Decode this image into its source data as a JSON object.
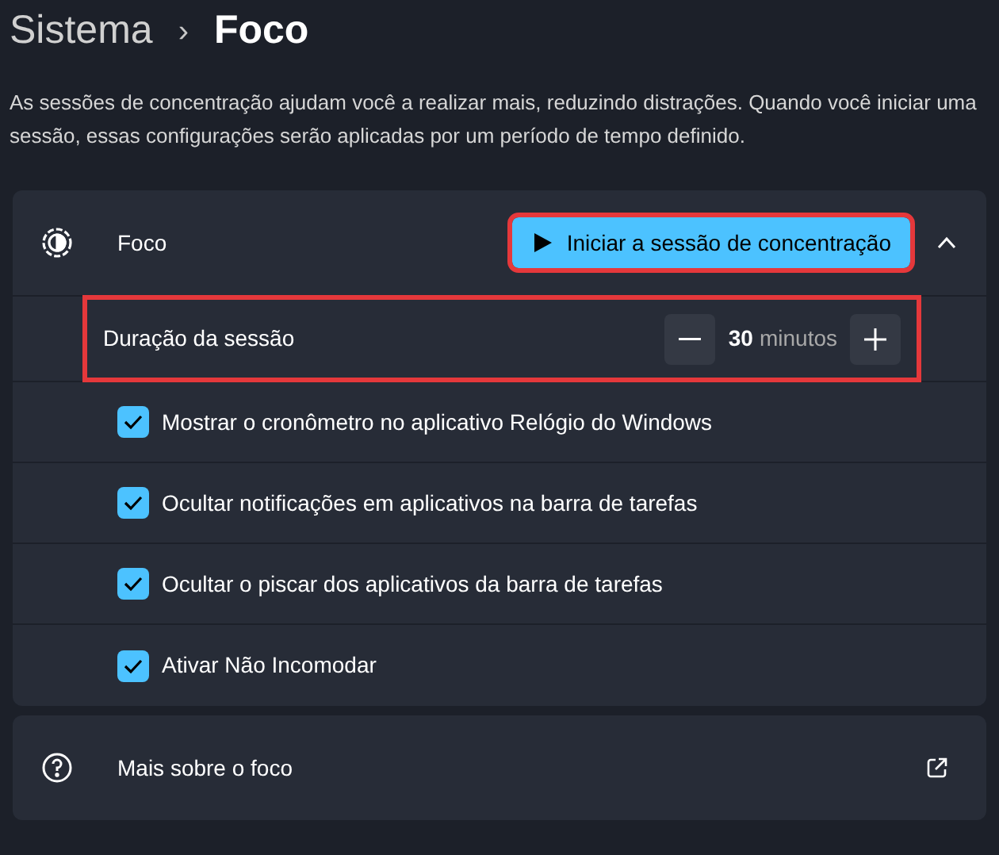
{
  "breadcrumb": {
    "parent": "Sistema",
    "separator": "›",
    "current": "Foco"
  },
  "description": "As sessões de concentração ajudam você a realizar mais, reduzindo distrações. Quando você iniciar uma sessão, essas configurações serão aplicadas por um período de tempo definido.",
  "focus_card": {
    "title": "Foco",
    "expanded": true,
    "start_button": {
      "label": "Iniciar a sessão de concentração",
      "highlighted": true
    },
    "duration": {
      "label": "Duração da sessão",
      "value": "30",
      "unit": "minutos",
      "highlighted": true
    },
    "options": [
      {
        "label": "Mostrar o cronômetro no aplicativo Relógio do Windows",
        "checked": true
      },
      {
        "label": "Ocultar notificações em aplicativos na barra de tarefas",
        "checked": true
      },
      {
        "label": "Ocultar o piscar dos aplicativos da barra de tarefas",
        "checked": true
      },
      {
        "label": "Ativar Não Incomodar",
        "checked": true
      }
    ]
  },
  "help_link": {
    "label": "Mais sobre o foco"
  }
}
